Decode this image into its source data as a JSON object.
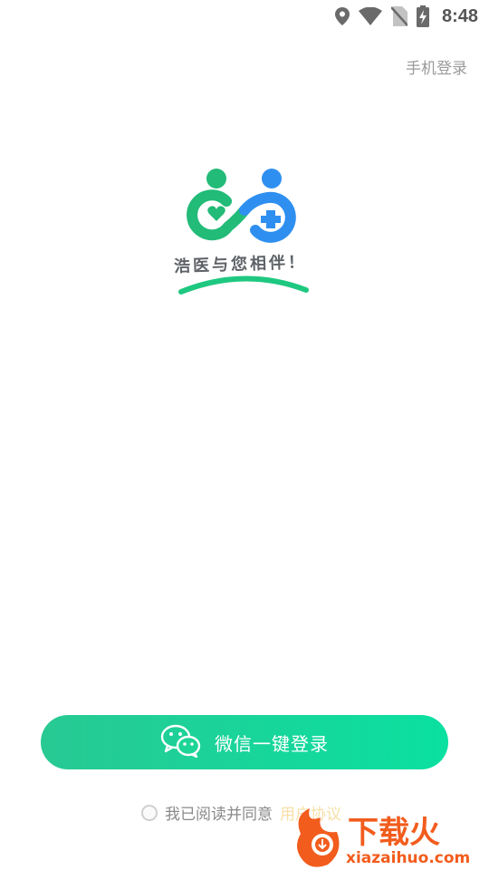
{
  "status_bar": {
    "time": "8:48",
    "icons": [
      "location-icon",
      "wifi-icon",
      "no-sim-icon",
      "battery-charging-icon"
    ]
  },
  "header": {
    "phone_login": "手机登录"
  },
  "logo": {
    "slogan": "浩医与您相伴！",
    "colors": {
      "green": "#22bb78",
      "blue": "#2f8ff0"
    }
  },
  "login": {
    "wechat_button_label": "微信一键登录",
    "wechat_icon": "wechat-icon",
    "button_color": "#14d69a"
  },
  "agreement": {
    "text": "我已阅读并同意",
    "link": "用户协议"
  },
  "watermark": {
    "brand": "下载火",
    "url": "xiazaihuo.com"
  }
}
